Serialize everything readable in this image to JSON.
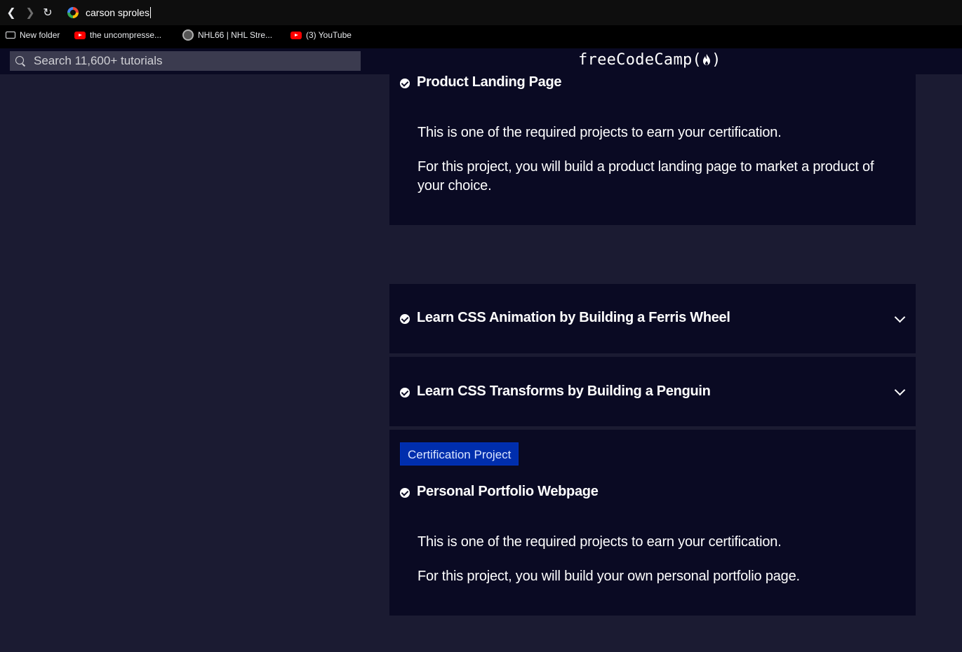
{
  "browser": {
    "address_text": "carson sproles",
    "bookmarks": [
      {
        "label": "New folder",
        "icon": "folder-icon"
      },
      {
        "label": "the uncompresse...",
        "icon": "youtube-icon"
      },
      {
        "label": "NHL66 | NHL Stre...",
        "icon": "nhl66-icon"
      },
      {
        "label": "(3) YouTube",
        "icon": "youtube-icon"
      }
    ]
  },
  "fcc_nav": {
    "search_placeholder": "Search 11,600+ tutorials",
    "logo_text": "freeCodeCamp(",
    "logo_close": ")"
  },
  "curriculum": {
    "product_landing": {
      "title": "Product Landing Page",
      "p1": "This is one of the required projects to earn your certification.",
      "p2": "For this project, you will build a product landing page to market a product of your choice."
    },
    "ferris_wheel": {
      "title": "Learn CSS Animation by Building a Ferris Wheel"
    },
    "penguin": {
      "title": "Learn CSS Transforms by Building a Penguin"
    },
    "portfolio": {
      "badge": "Certification Project",
      "title": "Personal Portfolio Webpage",
      "p1": "This is one of the required projects to earn your certification.",
      "p2": "For this project, you will build your own personal portfolio page."
    }
  },
  "colors": {
    "page_bg": "#1b1b32",
    "card_bg": "#0a0a23",
    "badge_bg": "#002ead"
  }
}
